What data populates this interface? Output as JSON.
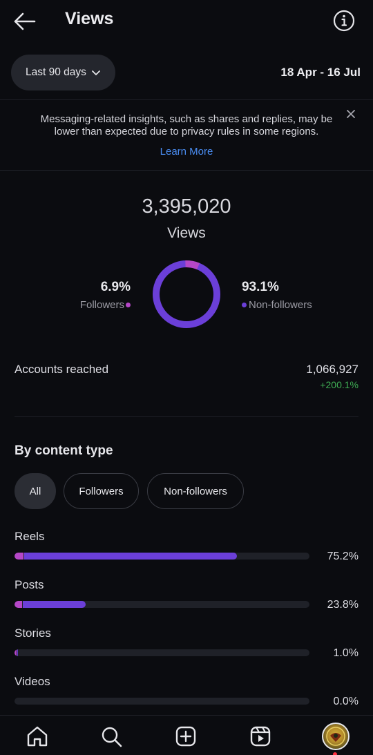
{
  "header": {
    "title": "Views"
  },
  "range": {
    "selector_label": "Last 90 days",
    "dates": "18 Apr - 16 Jul"
  },
  "notice": {
    "text": "Messaging-related insights, such as shares and replies, may be lower than expected due to privacy rules in some regions.",
    "link_label": "Learn More"
  },
  "summary": {
    "total_views": "3,395,020",
    "views_label": "Views",
    "followers_pct": "6.9%",
    "followers_label": "Followers",
    "non_followers_pct": "93.1%",
    "non_followers_label": "Non-followers",
    "followers_fraction": 0.069
  },
  "reach": {
    "label": "Accounts reached",
    "value": "1,066,927",
    "change": "+200.1%"
  },
  "content_type": {
    "title": "By content type",
    "filters": [
      "All",
      "Followers",
      "Non-followers"
    ],
    "selected_filter": "All",
    "rows": [
      {
        "label": "Reels",
        "pct": "75.2%",
        "followers_value": 3,
        "non_followers_value": 72.2
      },
      {
        "label": "Posts",
        "pct": "23.8%",
        "followers_value": 2.5,
        "non_followers_value": 21.3
      },
      {
        "label": "Stories",
        "pct": "1.0%",
        "followers_value": 0.7,
        "non_followers_value": 0.3
      },
      {
        "label": "Videos",
        "pct": "0.0%",
        "followers_value": 0,
        "non_followers_value": 0
      }
    ]
  },
  "colors": {
    "followers": "#b547c7",
    "non_followers": "#6b3fd8",
    "link": "#4a8df2",
    "positive": "#3fae54"
  },
  "nav": {
    "icons": [
      "home-icon",
      "search-icon",
      "create-icon",
      "reels-icon",
      "profile-avatar"
    ]
  }
}
